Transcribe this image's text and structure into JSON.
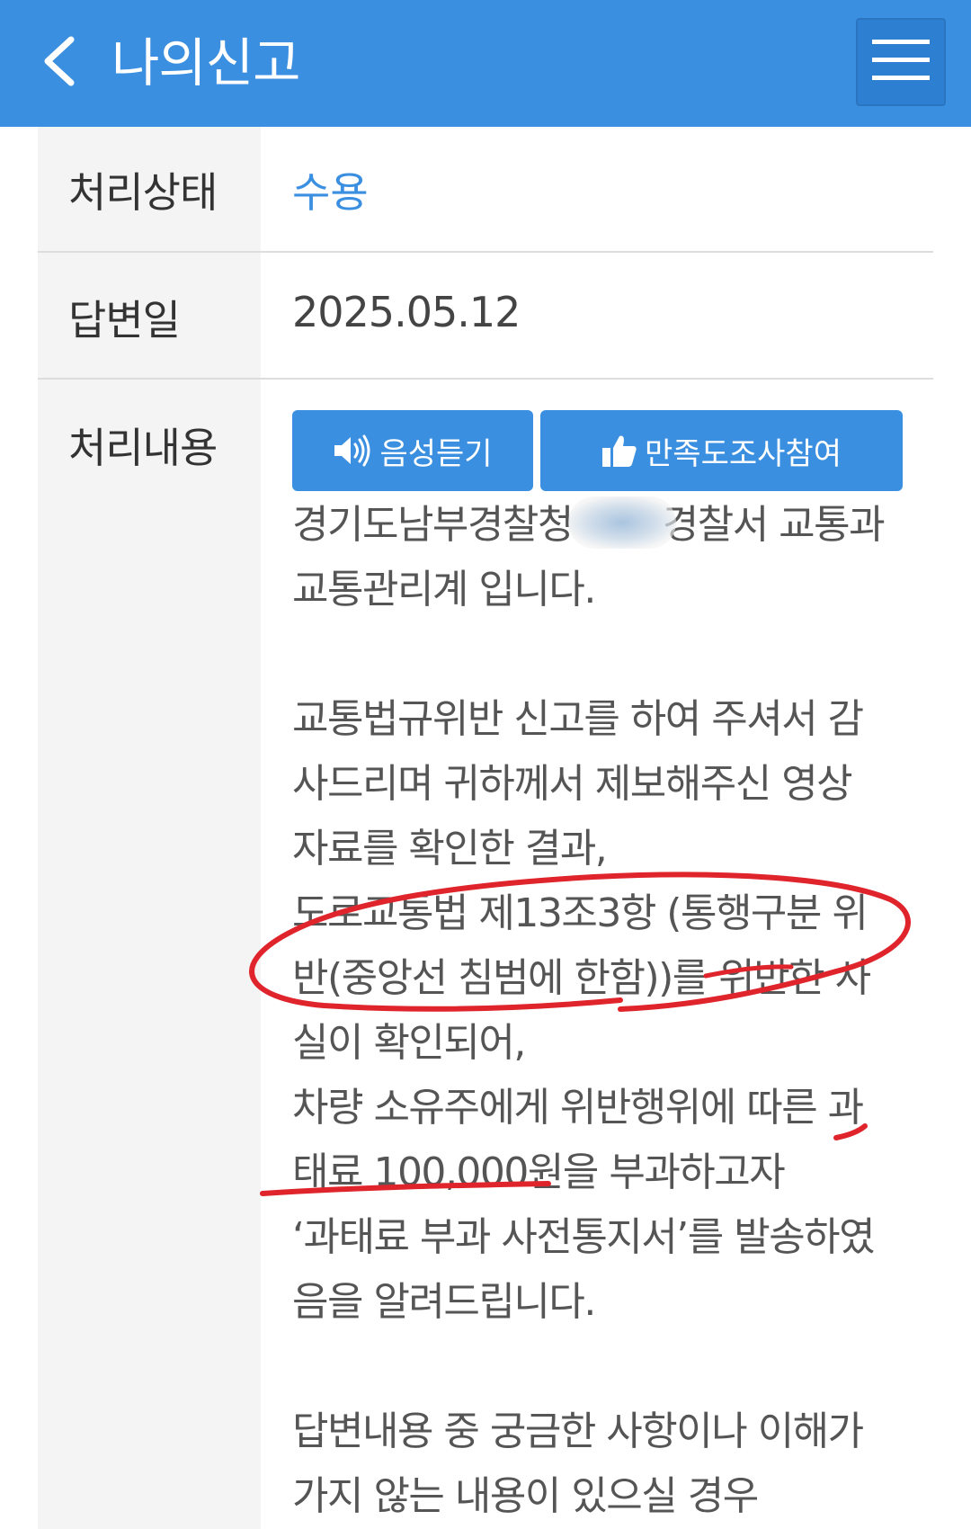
{
  "header": {
    "title": "나의신고",
    "back_icon": "chevron-left-icon",
    "menu_icon": "hamburger-menu-icon"
  },
  "rows": {
    "status": {
      "label": "처리상태",
      "value": "수용"
    },
    "answer_date": {
      "label": "답변일",
      "value": "2025.05.12"
    },
    "content": {
      "label": "처리내용"
    }
  },
  "buttons": {
    "listen_label": "음성듣기",
    "listen_icon": "speaker-icon",
    "survey_label": "만족도조사참여",
    "survey_icon": "thumbs-up-icon"
  },
  "content": {
    "paragraphs": [
      "경기도남부경찰청        경찰서 교통과\n교통관리계 입니다.",
      "교통법규위반 신고를 하여 주셔서 감\n사드리며 귀하께서 제보해주신 영상\n자료를 확인한 결과,\n도로교통법 제13조3항 (통행구분 위\n반(중앙선 침범에 한함))를 위반한 사\n실이 확인되어,\n차량 소유주에게 위반행위에 따른 과\n태료 100,000원을 부과하고자\n‘과태료 부과 사전통지서’를 발송하였\n음을 알려드립니다.",
      "답변내용 중 궁금한 사항이나 이해가\n가지 않는 내용이 있으실 경우"
    ]
  },
  "colors": {
    "primary": "#3b8fe0",
    "menu_button": "#2d7fd2",
    "label_bg": "#f4f4f4",
    "divider": "#dddddd",
    "annotation": "#e0242c"
  }
}
